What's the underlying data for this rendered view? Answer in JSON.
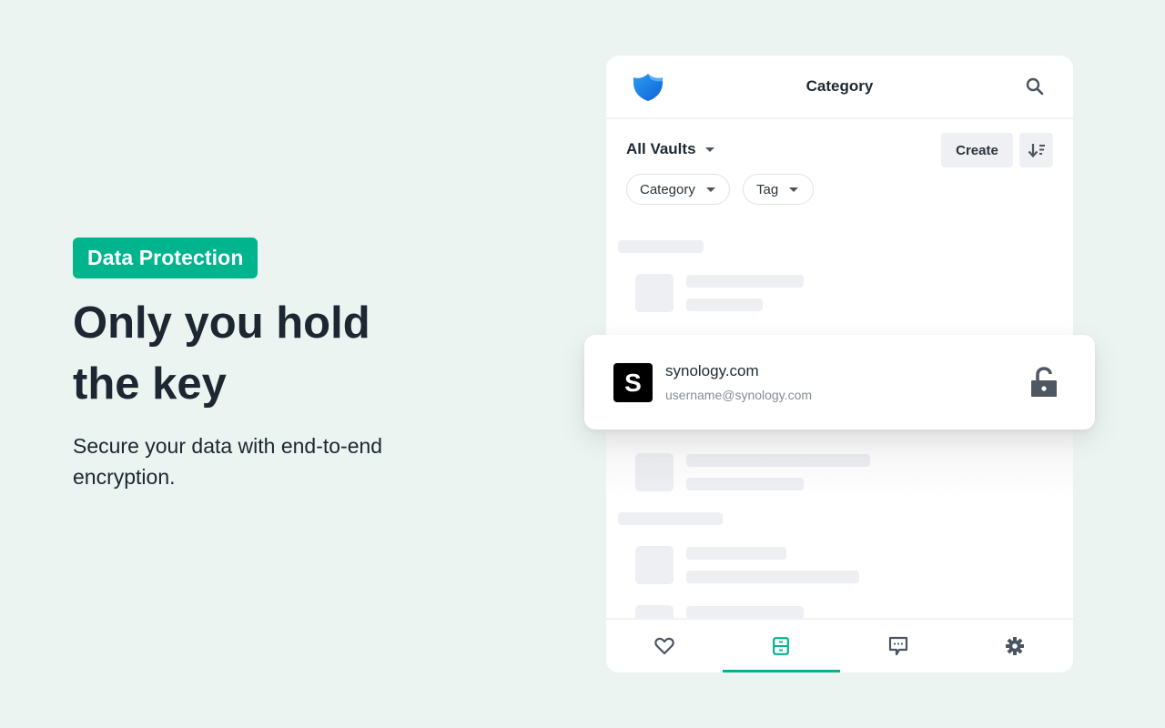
{
  "hero": {
    "badge": "Data Protection",
    "headline_line1": "Only you hold",
    "headline_line2": "the key",
    "subtitle": "Secure your data with end-to-end encryption."
  },
  "app": {
    "header": {
      "logo_icon": "shield-icon",
      "title": "Category",
      "search_icon": "search-icon"
    },
    "toolbar": {
      "vault_selector": "All Vaults",
      "create_label": "Create",
      "sort_icon": "sort-descending-icon"
    },
    "filters": [
      {
        "label": "Category"
      },
      {
        "label": "Tag"
      }
    ],
    "highlighted_item": {
      "avatar_letter": "S",
      "title": "synology.com",
      "username": "username@synology.com",
      "status_icon": "unlock-icon"
    },
    "bottom_nav": [
      {
        "name": "favorites",
        "icon": "heart-icon",
        "active": false
      },
      {
        "name": "items",
        "icon": "cabinet-icon",
        "active": true
      },
      {
        "name": "messages",
        "icon": "chat-icon",
        "active": false
      },
      {
        "name": "settings",
        "icon": "gear-icon",
        "active": false
      }
    ]
  },
  "colors": {
    "background": "#ebf4f0",
    "accent": "#00b48e",
    "text_dark": "#1d2731",
    "icon_gray": "#4a5560",
    "logo_blue": "#1a7fe8"
  }
}
